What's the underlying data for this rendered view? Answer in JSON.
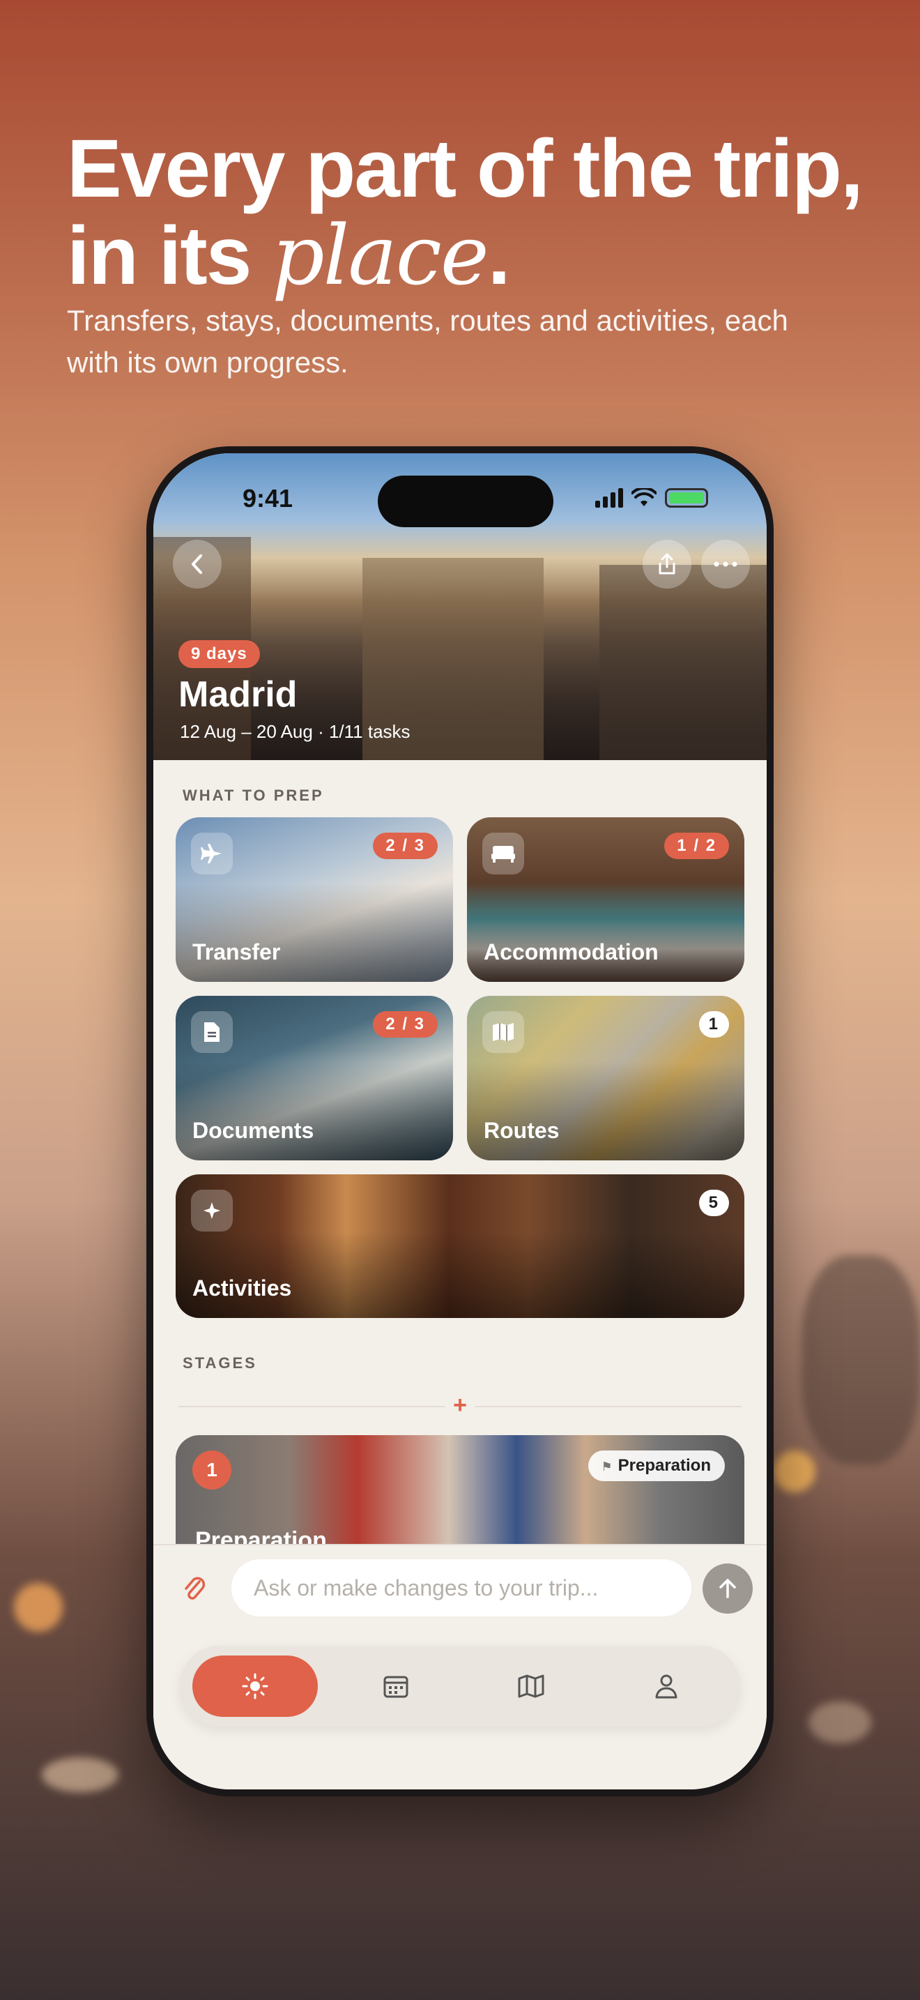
{
  "headline": {
    "line1": "Every part of the trip,",
    "line2_plain": "in its ",
    "line2_italic": "place",
    "line2_end": "."
  },
  "subhead": "Transfers, stays, documents, routes and activities, each with its own progress.",
  "status_bar": {
    "time": "9:41"
  },
  "trip": {
    "days_badge": "9 days",
    "city": "Madrid",
    "dates": "12 Aug – 20 Aug · 1/11 tasks"
  },
  "prep": {
    "section_label": "WHAT TO PREP",
    "cards": [
      {
        "label": "Transfer",
        "badge": "2 / 3",
        "icon": "airplane-icon"
      },
      {
        "label": "Accommodation",
        "badge": "1 / 2",
        "icon": "bed-icon"
      },
      {
        "label": "Documents",
        "badge": "2 / 3",
        "icon": "document-icon"
      },
      {
        "label": "Routes",
        "badge": "1",
        "icon": "map-icon"
      },
      {
        "label": "Activities",
        "badge": "5",
        "icon": "sparkle-icon"
      }
    ]
  },
  "stages": {
    "section_label": "STAGES",
    "add_symbol": "+",
    "items": [
      {
        "number": "1",
        "title": "Preparation",
        "tag": "Preparation"
      }
    ]
  },
  "composer": {
    "placeholder": "Ask or make changes to your trip..."
  },
  "tabbar": {
    "tabs": [
      "sun-icon",
      "calendar-icon",
      "map-icon",
      "person-icon"
    ],
    "active": "sun-icon"
  },
  "colors": {
    "accent": "#e0624a",
    "surface": "#f3efe9"
  }
}
